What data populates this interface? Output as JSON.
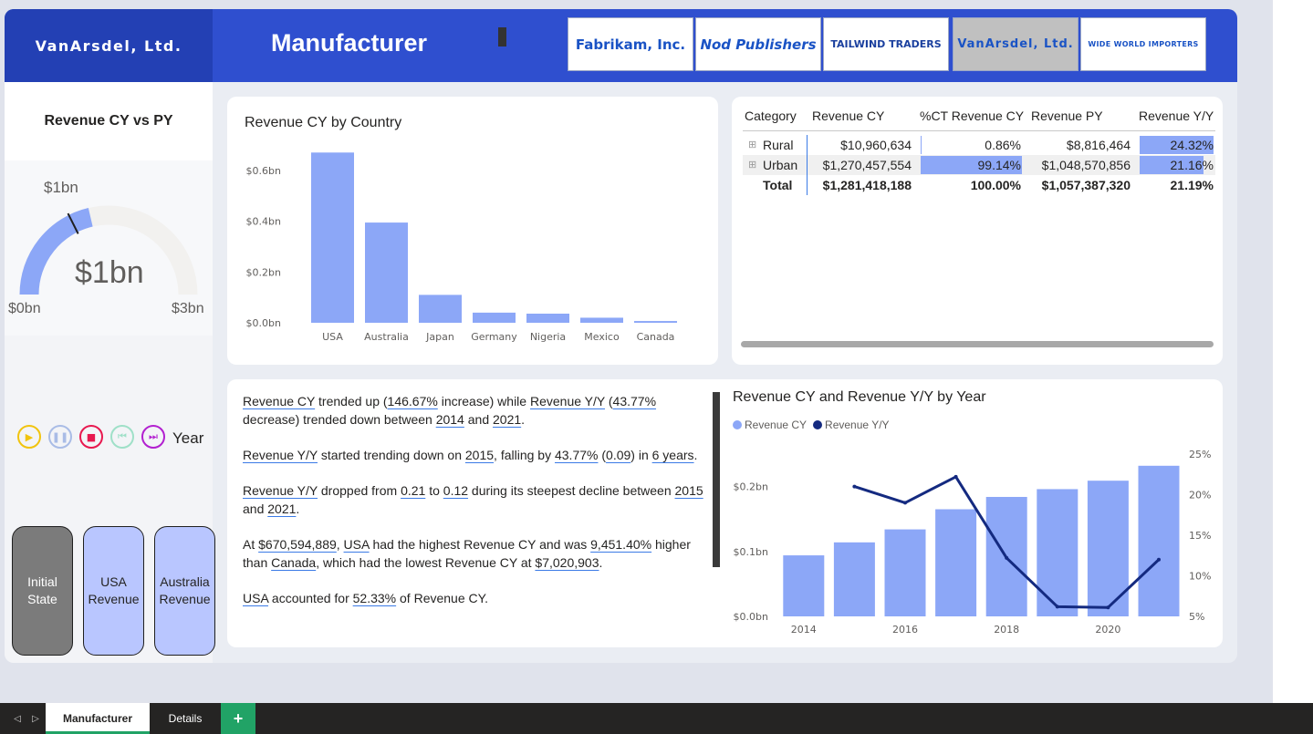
{
  "header": {
    "brand": "VanArsdel, Ltd.",
    "title": "Manufacturer",
    "manufacturers": [
      {
        "label": "Fabrikam, Inc.",
        "selected": false
      },
      {
        "label": "Nod Publishers",
        "selected": false
      },
      {
        "label": "TAILWIND TRADERS",
        "selected": false
      },
      {
        "label": "VanArsdel, Ltd.",
        "selected": true
      },
      {
        "label": "WIDE WORLD IMPORTERS",
        "selected": false
      }
    ]
  },
  "gauge": {
    "title": "Revenue CY vs PY",
    "value_label": "$1bn",
    "target_label": "$1bn",
    "min_label": "$0bn",
    "max_label": "$3bn",
    "value": 1.281,
    "target": 1.057,
    "min": 0,
    "max": 3,
    "colors": {
      "fill": "#8ca7f7",
      "track": "#f2f1ef",
      "target": "#1f1f1f"
    }
  },
  "play_axis": {
    "label": "Year",
    "buttons": [
      {
        "icon": "play-icon",
        "glyph": "▶",
        "color": "#f1c40f"
      },
      {
        "icon": "pause-icon",
        "glyph": "❚❚",
        "color": "#a9bce6"
      },
      {
        "icon": "stop-icon",
        "glyph": "■",
        "color": "#e8184f"
      },
      {
        "icon": "previous-icon",
        "glyph": "⏮",
        "color": "#9fe0c8"
      },
      {
        "icon": "next-icon",
        "glyph": "⏭",
        "color": "#b220d0"
      }
    ]
  },
  "bookmarks": [
    {
      "label": "Initial State",
      "lines": [
        "Initial",
        "State"
      ],
      "bg": "#7b7b7b",
      "fg": "#ffffff"
    },
    {
      "label": "USA Revenue",
      "lines": [
        "USA",
        "Revenue"
      ],
      "bg": "#b9c6ff",
      "fg": "#252423"
    },
    {
      "label": "Australia Revenue",
      "lines": [
        "Australia",
        "Revenue"
      ],
      "bg": "#b9c6ff",
      "fg": "#252423"
    }
  ],
  "matrix": {
    "headers": [
      "Category",
      "Revenue CY",
      "%CT Revenue CY",
      "Revenue PY",
      "Revenue Y/Y"
    ],
    "rows": [
      {
        "category": "Rural",
        "revenue_cy": "$10,960,634",
        "pct_ct": "0.86%",
        "pct_ct_value": 0.86,
        "revenue_py": "$8,816,464",
        "yy": "24.32%",
        "yy_value": 24.32
      },
      {
        "category": "Urban",
        "revenue_cy": "$1,270,457,554",
        "pct_ct": "99.14%",
        "pct_ct_value": 99.14,
        "revenue_py": "$1,048,570,856",
        "yy": "21.16%",
        "yy_value": 21.16
      }
    ],
    "total": {
      "category": "Total",
      "revenue_cy": "$1,281,418,188",
      "pct_ct": "100.00%",
      "revenue_py": "$1,057,387,320",
      "yy": "21.19%"
    },
    "expand_glyph": "⊞",
    "bar_color": "#8ca7f7"
  },
  "narrative": [
    [
      {
        "t": "Revenue CY",
        "hl": true
      },
      {
        "t": " trended up ("
      },
      {
        "t": "146.67%",
        "hl": true
      },
      {
        "t": " increase) while "
      },
      {
        "t": "Revenue Y/Y",
        "hl": true
      },
      {
        "t": " ("
      },
      {
        "t": "43.77%",
        "hl": true
      },
      {
        "t": " decrease) trended down between "
      },
      {
        "t": "2014",
        "hl": true
      },
      {
        "t": " and "
      },
      {
        "t": "2021",
        "hl": true
      },
      {
        "t": "."
      }
    ],
    [
      {
        "t": "Revenue Y/Y",
        "hl": true
      },
      {
        "t": " started trending down on "
      },
      {
        "t": "2015",
        "hl": true
      },
      {
        "t": ", falling by "
      },
      {
        "t": "43.77%",
        "hl": true
      },
      {
        "t": " ("
      },
      {
        "t": "0.09",
        "hl": true
      },
      {
        "t": ") in "
      },
      {
        "t": "6 years",
        "hl": true
      },
      {
        "t": "."
      }
    ],
    [
      {
        "t": "Revenue Y/Y",
        "hl": true
      },
      {
        "t": " dropped from "
      },
      {
        "t": "0.21",
        "hl": true
      },
      {
        "t": " to "
      },
      {
        "t": "0.12",
        "hl": true
      },
      {
        "t": " during its steepest decline between "
      },
      {
        "t": "2015",
        "hl": true
      },
      {
        "t": " and "
      },
      {
        "t": "2021",
        "hl": true
      },
      {
        "t": "."
      }
    ],
    [
      {
        "t": "At "
      },
      {
        "t": "$670,594,889",
        "hl": true
      },
      {
        "t": ", "
      },
      {
        "t": "USA",
        "hl": true
      },
      {
        "t": " had the highest Revenue CY and was "
      },
      {
        "t": "9,451.40%",
        "hl": true
      },
      {
        "t": " higher than "
      },
      {
        "t": "Canada",
        "hl": true
      },
      {
        "t": ", which had the lowest Revenue CY at "
      },
      {
        "t": "$7,020,903",
        "hl": true
      },
      {
        "t": "."
      }
    ],
    [
      {
        "t": "USA",
        "hl": true
      },
      {
        "t": " accounted for "
      },
      {
        "t": "52.33%",
        "hl": true
      },
      {
        "t": " of Revenue CY."
      }
    ]
  ],
  "tabs": [
    {
      "label": "Manufacturer",
      "active": true
    },
    {
      "label": "Details",
      "active": false
    }
  ],
  "tab_add_label": "+",
  "tab_nav": {
    "prev": "◁",
    "next": "▷"
  },
  "colors": {
    "accent": "#2f4fcf",
    "bar": "#8ca7f7",
    "line": "#142a80",
    "add_tab": "#21a366"
  },
  "chart_data": [
    {
      "type": "bar",
      "title": "Revenue CY by Country",
      "categories": [
        "USA",
        "Australia",
        "Japan",
        "Germany",
        "Nigeria",
        "Mexico",
        "Canada"
      ],
      "values": [
        0.671,
        0.395,
        0.11,
        0.04,
        0.036,
        0.02,
        0.007
      ],
      "ylim": [
        0,
        0.69
      ],
      "yticks": [
        0,
        0.2,
        0.4,
        0.6
      ],
      "ytick_labels": [
        "$0.0bn",
        "$0.2bn",
        "$0.4bn",
        "$0.6bn"
      ],
      "grid": false,
      "color": "#8ca7f7"
    },
    {
      "type": "bar",
      "title": "Revenue CY and Revenue Y/Y by Year",
      "legend": [
        "Revenue CY",
        "Revenue Y/Y"
      ],
      "legend_position": "top-left",
      "x": [
        2014,
        2015,
        2016,
        2017,
        2018,
        2019,
        2020,
        2021
      ],
      "xtick_labels": [
        "2014",
        "2016",
        "2018",
        "2020"
      ],
      "xticks": [
        2014,
        2016,
        2018,
        2020
      ],
      "series": [
        {
          "name": "Revenue CY",
          "type": "bar",
          "axis": "left",
          "color": "#8ca7f7",
          "values": [
            0.094,
            0.114,
            0.134,
            0.165,
            0.184,
            0.196,
            0.209,
            0.232
          ]
        },
        {
          "name": "Revenue Y/Y",
          "type": "line",
          "axis": "right",
          "color": "#142a80",
          "x": [
            2015,
            2016,
            2017,
            2018,
            2019,
            2020,
            2021
          ],
          "values": [
            21.0,
            19.0,
            22.2,
            12.2,
            6.2,
            6.1,
            12.0
          ]
        }
      ],
      "ylim_left": [
        0,
        0.25
      ],
      "yticks_left": [
        0,
        0.1,
        0.2
      ],
      "ytick_labels_left": [
        "$0.0bn",
        "$0.1bn",
        "$0.2bn"
      ],
      "ylim_right": [
        5,
        25
      ],
      "yticks_right": [
        5,
        10,
        15,
        20,
        25
      ],
      "ytick_labels_right": [
        "5%",
        "10%",
        "15%",
        "20%",
        "25%"
      ]
    }
  ]
}
